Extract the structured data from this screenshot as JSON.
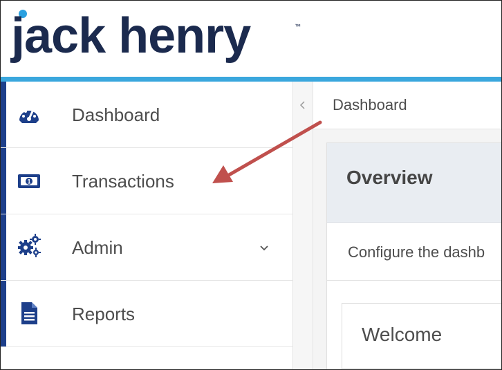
{
  "brand": {
    "logo_text": "jack henry",
    "trademark": "™",
    "colors": {
      "navy": "#1b2a4e",
      "sky": "#3aa7dd"
    }
  },
  "sidebar": {
    "items": [
      {
        "label": "Dashboard",
        "icon": "dashboard-gauge-icon"
      },
      {
        "label": "Transactions",
        "icon": "transactions-money-icon"
      },
      {
        "label": "Admin",
        "icon": "admin-gears-icon",
        "expandable": true
      },
      {
        "label": "Reports",
        "icon": "reports-document-icon"
      }
    ],
    "accent_color": "#1d3f8a"
  },
  "collapse": {
    "icon": "chevron-left-icon"
  },
  "breadcrumb": {
    "current": "Dashboard"
  },
  "overview": {
    "title": "Overview",
    "description": "Configure the dashb"
  },
  "welcome": {
    "title": "Welcome"
  },
  "annotation": {
    "color": "#c0504d",
    "points_to": "Transactions"
  }
}
